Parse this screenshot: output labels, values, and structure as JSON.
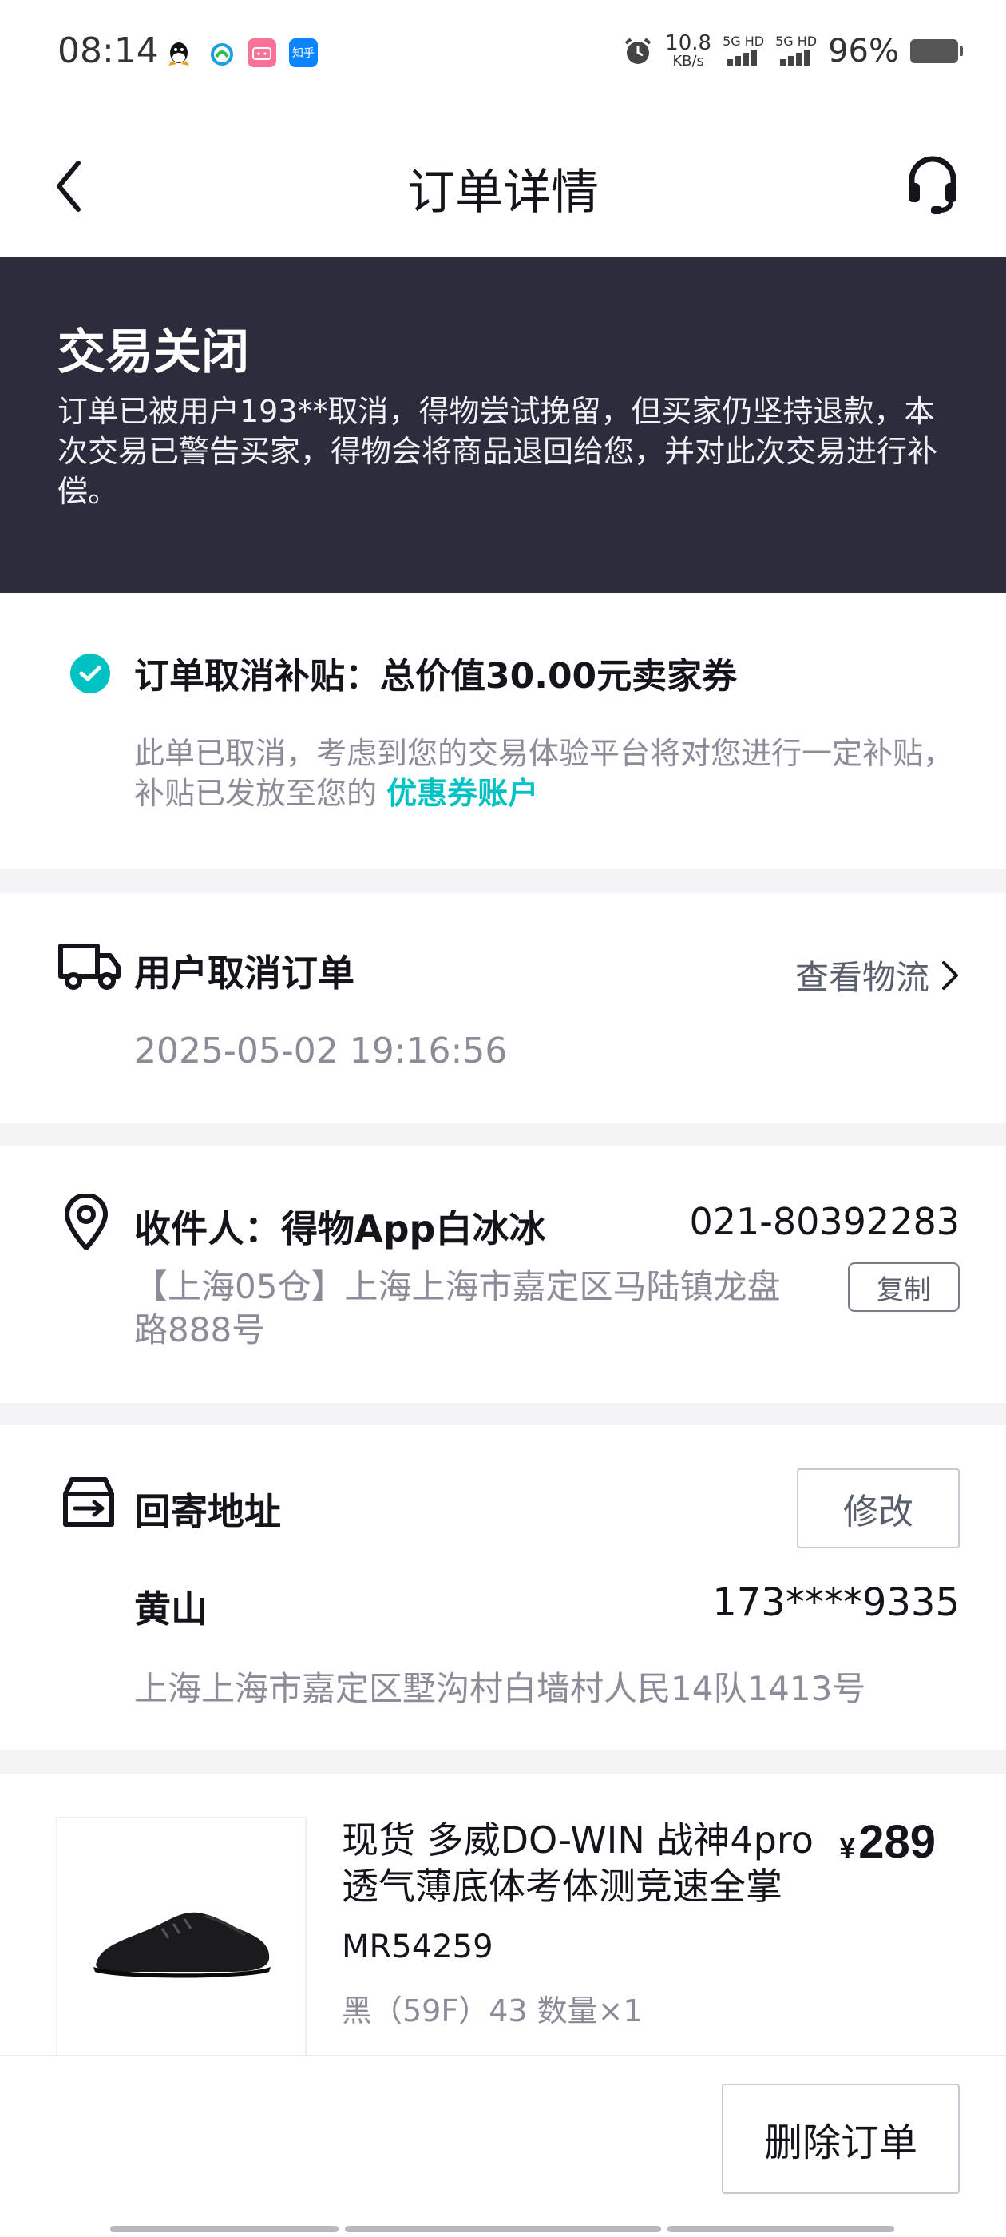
{
  "status_bar": {
    "time": "08:14",
    "apps": [
      "qq-icon",
      "mobile-icon",
      "bilibili-icon",
      "zhihu-icon"
    ],
    "zhihu_label": "知乎",
    "speed_value": "10.8",
    "speed_unit": "KB/s",
    "sim1": "5G HD",
    "sim2": "5G HD",
    "battery": "96%"
  },
  "nav": {
    "title": "订单详情"
  },
  "banner": {
    "title": "交易关闭",
    "message": "订单已被用户193**取消，得物尝试挽留，但买家仍坚持退款，本次交易已警告买家，得物会将商品退回给您，并对此次交易进行补偿。"
  },
  "subsidy": {
    "title": "订单取消补贴：总价值30.00元卖家券",
    "desc": "此单已取消，考虑到您的交易体验平台将对您进行一定补贴，补贴已发放至您的",
    "link": "优惠券账户"
  },
  "cancel": {
    "title": "用户取消订单",
    "logistics_link": "查看物流",
    "time": "2025-05-02 19:16:56"
  },
  "recipient": {
    "label": "收件人：得物App白冰冰",
    "phone": "021-80392283",
    "address": "【上海05仓】上海上海市嘉定区马陆镇龙盘路888号",
    "copy_label": "复制"
  },
  "return_address": {
    "title": "回寄地址",
    "edit_label": "修改",
    "name": "黄山",
    "phone": "173****9335",
    "address": "上海上海市嘉定区墅沟村白墙村人民14队1413号"
  },
  "product": {
    "name": "现货 多威DO-WIN 战神4pro 透气薄底体考体测竞速全掌",
    "currency": "¥",
    "price": "289",
    "sku": "MR54259",
    "spec": "黑（59F）43 数量×1"
  },
  "bottom": {
    "delete_label": "删除订单"
  },
  "colors": {
    "accent": "#01c2c3",
    "banner_bg": "#2b2c3c"
  }
}
